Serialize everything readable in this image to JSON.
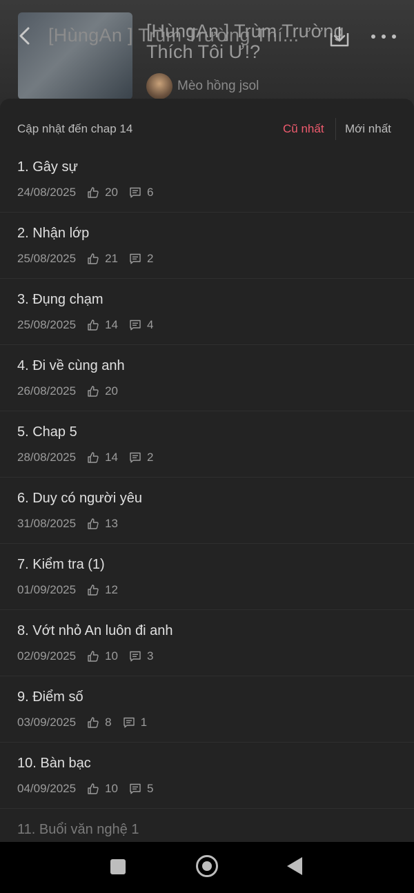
{
  "header": {
    "cover_title": "[HùngAn ] Trùm Trường Thí...",
    "title": "[HùngAn ] Trùm Trường Thích Tôi Ư!?",
    "author": "Mèo hồng jsol"
  },
  "sheet": {
    "update_text": "Cập nhật đến chap 14",
    "sort_oldest": "Cũ nhất",
    "sort_newest": "Mới nhất"
  },
  "chapters": [
    {
      "title": "1. Gây sự",
      "date": "24/08/2025",
      "likes": "20",
      "comments": "6"
    },
    {
      "title": "2. Nhận lớp",
      "date": "25/08/2025",
      "likes": "21",
      "comments": "2"
    },
    {
      "title": "3. Đụng chạm",
      "date": "25/08/2025",
      "likes": "14",
      "comments": "4"
    },
    {
      "title": "4. Đi về cùng anh",
      "date": "26/08/2025",
      "likes": "20",
      "comments": ""
    },
    {
      "title": "5. Chap 5",
      "date": "28/08/2025",
      "likes": "14",
      "comments": "2"
    },
    {
      "title": "6. Duy có người yêu",
      "date": "31/08/2025",
      "likes": "13",
      "comments": ""
    },
    {
      "title": "7. Kiểm tra (1)",
      "date": "01/09/2025",
      "likes": "12",
      "comments": ""
    },
    {
      "title": "8. Vớt nhỏ An luôn đi anh",
      "date": "02/09/2025",
      "likes": "10",
      "comments": "3"
    },
    {
      "title": "9. Điểm số",
      "date": "03/09/2025",
      "likes": "8",
      "comments": "1"
    },
    {
      "title": "10. Bàn bạc",
      "date": "04/09/2025",
      "likes": "10",
      "comments": "5"
    },
    {
      "title": "11. Buổi văn nghệ 1",
      "date": "",
      "likes": "",
      "comments": ""
    }
  ],
  "icons": {
    "back": "chevron-left-icon",
    "download": "download-icon",
    "more": "more-dots-icon",
    "like": "thumbs-up-icon",
    "comment": "comment-icon"
  },
  "colors": {
    "accent": "#ef5b6e",
    "background": "#232323",
    "text": "#e0e0e0",
    "muted": "#9c9c9c"
  }
}
